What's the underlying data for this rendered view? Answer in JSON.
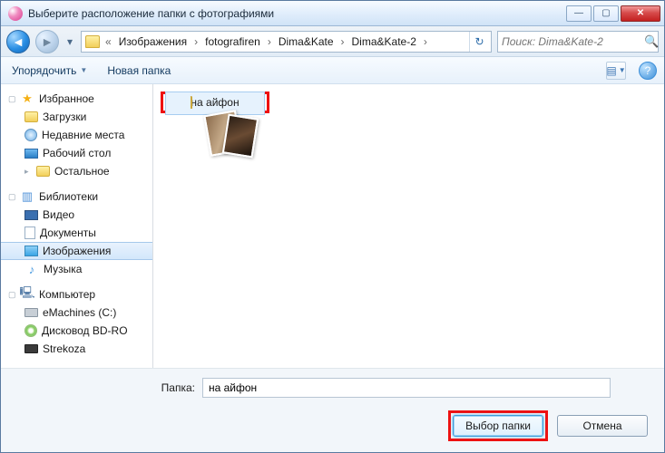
{
  "title": "Выберите расположение папки с фотографиями",
  "nav": {
    "crumbs": [
      "Изображения",
      "fotografiren",
      "Dima&Kate",
      "Dima&Kate-2"
    ],
    "search_placeholder": "Поиск: Dima&Kate-2"
  },
  "toolbar": {
    "organize": "Упорядочить",
    "newfolder": "Новая папка"
  },
  "sidebar": {
    "favorites": {
      "label": "Избранное",
      "items": [
        "Загрузки",
        "Недавние места",
        "Рабочий стол",
        "Остальное"
      ]
    },
    "libraries": {
      "label": "Библиотеки",
      "items": [
        "Видео",
        "Документы",
        "Изображения",
        "Музыка"
      ]
    },
    "computer": {
      "label": "Компьютер",
      "items": [
        "eMachines (C:)",
        "Дисковод BD-RO",
        "Strekoza"
      ]
    }
  },
  "content": {
    "folder_name": "на айфон"
  },
  "footer": {
    "label": "Папка:",
    "value": "на айфон",
    "select": "Выбор папки",
    "cancel": "Отмена"
  }
}
